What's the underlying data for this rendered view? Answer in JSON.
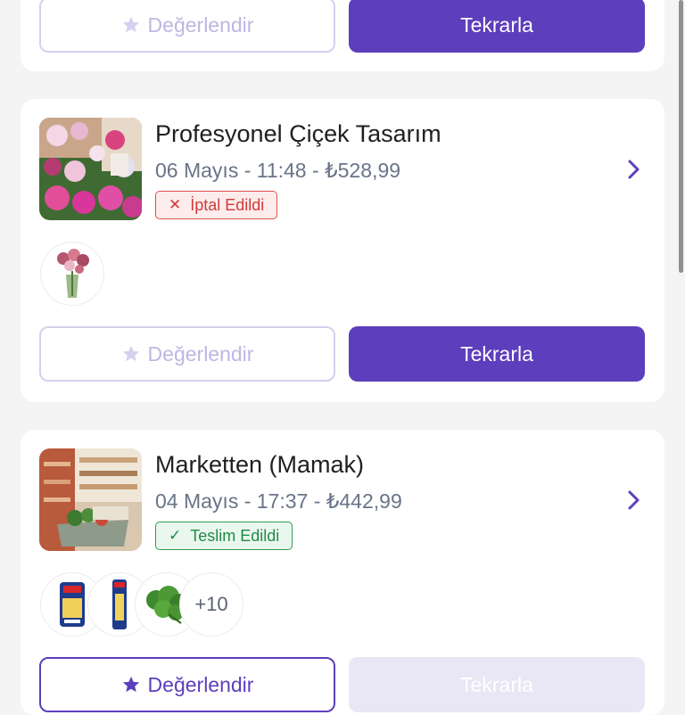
{
  "order_top": {
    "rate_label": "Değerlendir",
    "repeat_label": "Tekrarla"
  },
  "order1": {
    "title": "Profesyonel Çiçek Tasarım",
    "meta": "06 Mayıs - 11:48 - ₺528,99",
    "status": "İptal Edildi",
    "rate_label": "Değerlendir",
    "repeat_label": "Tekrarla"
  },
  "order2": {
    "title": "Marketten (Mamak)",
    "meta": "04 Mayıs - 17:37 - ₺442,99",
    "status": "Teslim Edildi",
    "more_count": "+10",
    "rate_label": "Değerlendir",
    "repeat_label": "Tekrarla"
  },
  "colors": {
    "primary": "#5d3ebc",
    "cancel": "#d13a3a",
    "delivered": "#218a47"
  }
}
